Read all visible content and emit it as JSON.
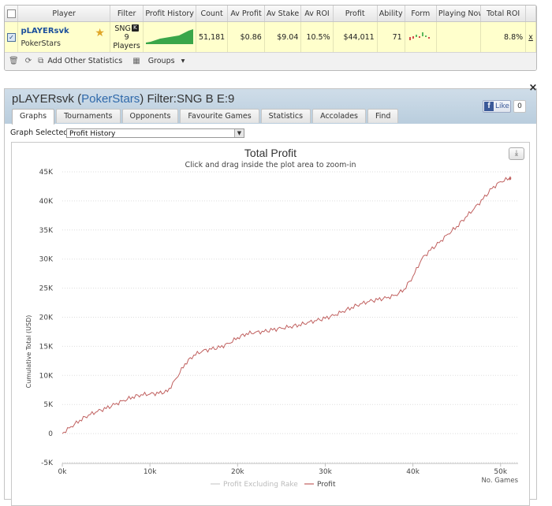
{
  "stats_table": {
    "columns": [
      "Player",
      "Filter",
      "Profit History",
      "Count",
      "Av Profit",
      "Av Stake",
      "Av ROI",
      "Profit",
      "Ability",
      "Form",
      "Playing Now",
      "Total ROI"
    ],
    "row": {
      "player_name": "pLAYERsvk",
      "site": "PokerStars",
      "filter_line1": "SNG",
      "filter_badge": "K",
      "filter_line2": "9",
      "filter_line3": "Players",
      "count": "51,181",
      "av_profit": "$0.86",
      "av_stake": "$9.04",
      "av_roi": "10.5%",
      "profit": "$44,011",
      "ability": "71",
      "playing_now": "",
      "total_roi": "8.8%",
      "action_glyph": "x"
    },
    "footer": {
      "add_stats_label": "Add Other Statistics",
      "groups_label": "Groups"
    }
  },
  "panel": {
    "title_player": "pLAYERsvk",
    "title_site_open": "(",
    "title_site": "PokerStars",
    "title_site_close": ")",
    "title_filter": "Filter:SNG B E:9",
    "like_label": "Like",
    "like_count": "0",
    "tabs": [
      "Graphs",
      "Tournaments",
      "Opponents",
      "Favourite Games",
      "Statistics",
      "Accolades",
      "Find"
    ],
    "active_tab": "Graphs",
    "graph_selected_label": "Graph Selected:",
    "graph_selected_value": "Profit History"
  },
  "chart_data": {
    "type": "line",
    "title": "Total Profit",
    "subtitle": "Click and drag inside the plot area to zoom-in",
    "ylabel": "Cumulative Total (USD)",
    "xlabel": "No. Games",
    "ylim": [
      -5000,
      45000
    ],
    "xlim": [
      0,
      52000
    ],
    "y_ticks": [
      -5000,
      0,
      5000,
      10000,
      15000,
      20000,
      25000,
      30000,
      35000,
      40000,
      45000
    ],
    "y_tick_labels": [
      "-5K",
      "0",
      "5K",
      "10K",
      "15K",
      "20K",
      "25K",
      "30K",
      "35K",
      "40K",
      "45K"
    ],
    "x_ticks": [
      0,
      10000,
      20000,
      30000,
      40000,
      50000
    ],
    "x_tick_labels": [
      "0k",
      "10k",
      "20k",
      "30k",
      "40k",
      "50k"
    ],
    "grid": "horizontal-dashed",
    "legend_placement": "bottom",
    "series": [
      {
        "name": "Profit Excluding Rake",
        "color": "#d9d9d9",
        "visible": false,
        "x": [],
        "y": []
      },
      {
        "name": "Profit",
        "color": "#c0605f",
        "x": [
          0,
          1000,
          2000,
          3000,
          4000,
          5000,
          6000,
          7000,
          8000,
          9000,
          10000,
          11000,
          12000,
          13000,
          14000,
          15000,
          16000,
          17000,
          18000,
          19000,
          20000,
          21000,
          22000,
          23000,
          24000,
          25000,
          26000,
          27000,
          28000,
          29000,
          30000,
          31000,
          32000,
          33000,
          34000,
          35000,
          36000,
          37000,
          38000,
          39000,
          40000,
          41000,
          42000,
          43000,
          44000,
          45000,
          46000,
          47000,
          48000,
          49000,
          50000,
          51000,
          51181
        ],
        "y": [
          0,
          1200,
          2300,
          3200,
          3800,
          4300,
          5000,
          5700,
          6300,
          6700,
          6800,
          6900,
          7200,
          9500,
          12000,
          13500,
          14200,
          14500,
          14800,
          15500,
          16500,
          17200,
          17400,
          17500,
          17800,
          18100,
          18400,
          18700,
          19100,
          19400,
          19800,
          20300,
          21000,
          21700,
          22300,
          22700,
          23000,
          23300,
          23800,
          24800,
          27000,
          30000,
          31500,
          32800,
          34300,
          35600,
          37200,
          38700,
          40300,
          42100,
          43300,
          43900,
          44011
        ]
      }
    ]
  },
  "colors": {
    "header_bg": "#c6d7e6",
    "highlight_row": "#ffffcc",
    "profit_line": "#c0605f",
    "sparkline": "#3aa64a",
    "link_blue": "#2f69aa"
  }
}
